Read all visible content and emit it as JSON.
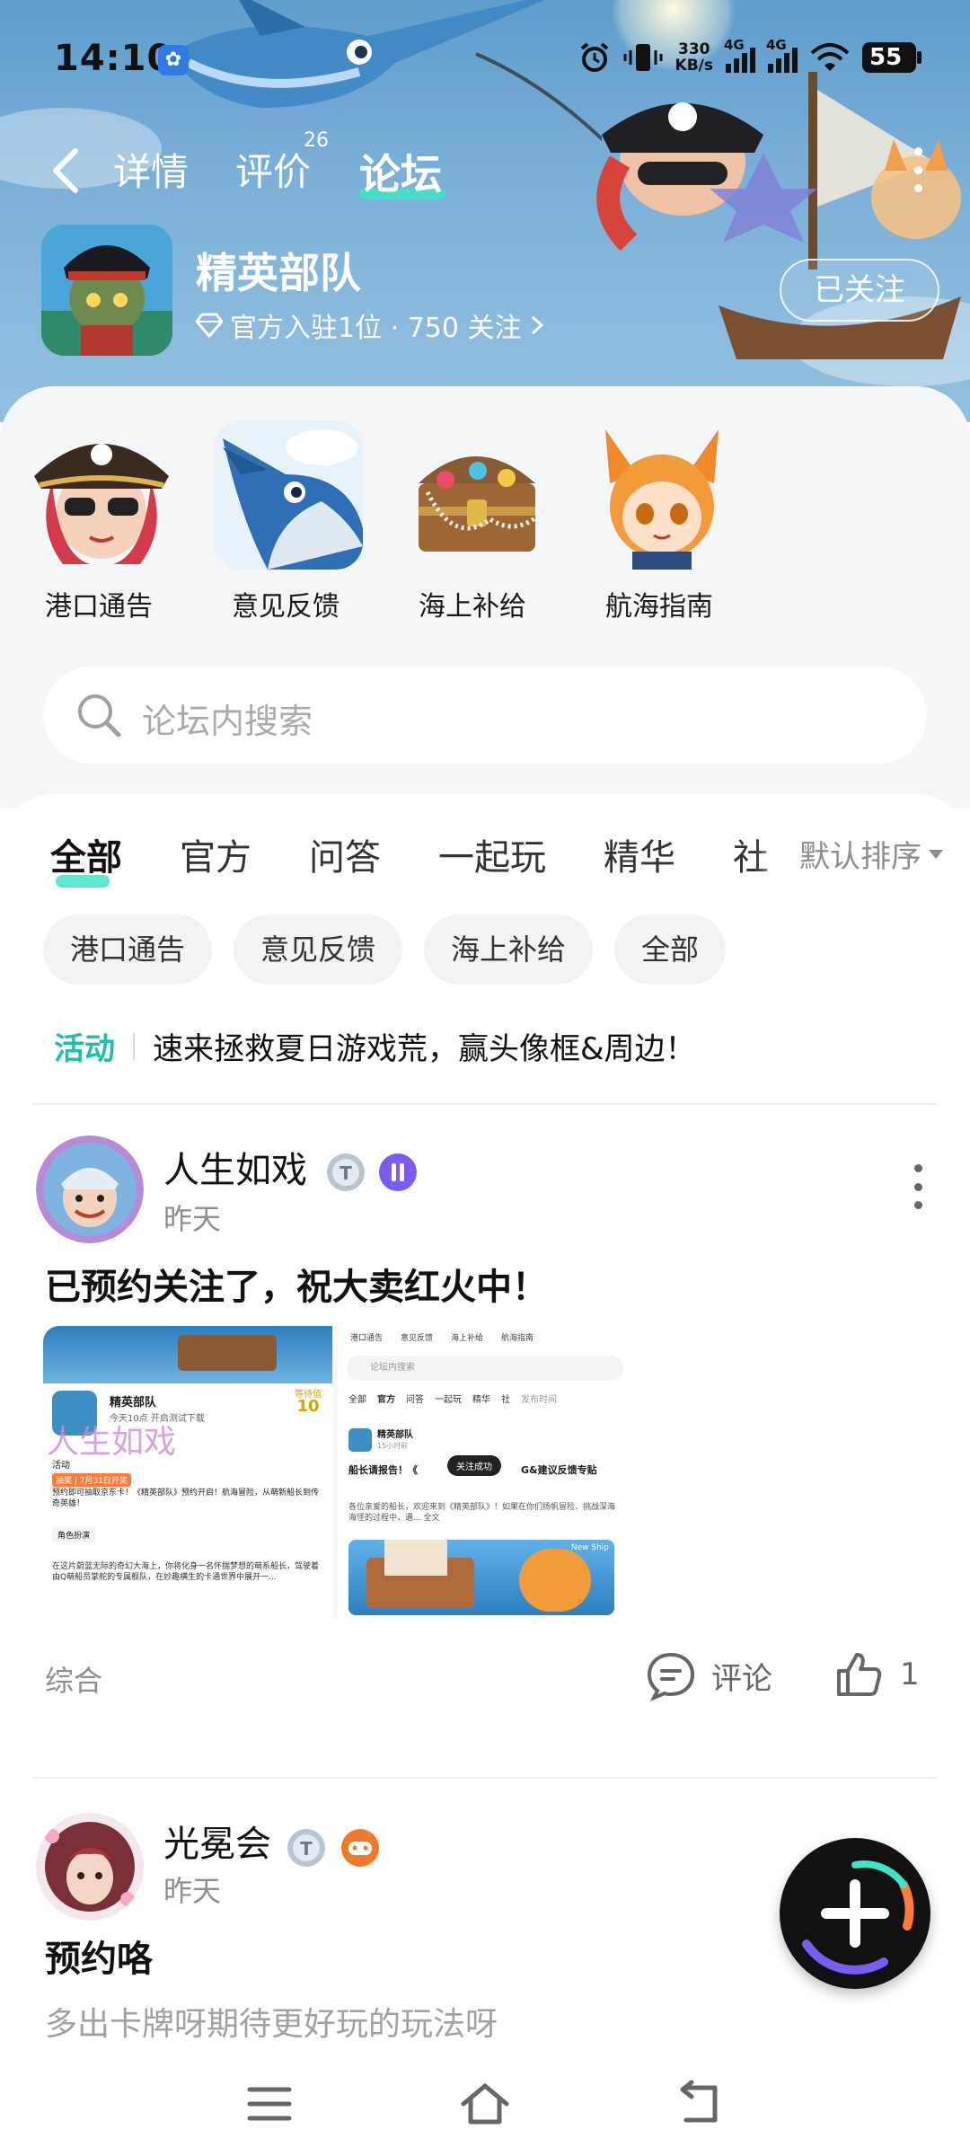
{
  "status_bar": {
    "time": "14:10",
    "app_icon": "baidu-paw-icon",
    "net_speed_value": "330",
    "net_speed_unit": "KB/s",
    "signal_1": "4G",
    "signal_2": "4G",
    "battery": "55"
  },
  "header": {
    "back_icon": "chevron-left-icon",
    "tabs": [
      {
        "label": "详情",
        "active": false
      },
      {
        "label": "评价",
        "badge": "26",
        "active": false
      },
      {
        "label": "论坛",
        "active": true
      }
    ],
    "more_icon": "more-vertical-icon"
  },
  "forum": {
    "name": "精英部队",
    "meta_text": "官方入驻1位 · 750 关注",
    "follow_label": "已关注"
  },
  "shortcuts": [
    {
      "label": "港口通告",
      "icon": "pirate-girl-icon"
    },
    {
      "label": "意见反馈",
      "icon": "swordfish-icon"
    },
    {
      "label": "海上补给",
      "icon": "treasure-chest-icon"
    },
    {
      "label": "航海指南",
      "icon": "fox-girl-icon"
    }
  ],
  "search": {
    "placeholder": "论坛内搜索"
  },
  "feed_tabs": [
    {
      "label": "全部",
      "active": true
    },
    {
      "label": "官方",
      "active": false
    },
    {
      "label": "问答",
      "active": false
    },
    {
      "label": "一起玩",
      "active": false
    },
    {
      "label": "精华",
      "active": false
    },
    {
      "label": "社",
      "active": false
    }
  ],
  "sort_label": "默认排序",
  "chips": [
    "港口通告",
    "意见反馈",
    "海上补给",
    "全部"
  ],
  "activity": {
    "tag": "活动",
    "text": "速来拯救夏日游戏荒，赢头像框&周边！"
  },
  "posts": [
    {
      "author": "人生如戏",
      "time": "昨天",
      "title": "已预约关注了，祝大卖红火中！",
      "category": "综合",
      "comment_label": "评论",
      "likes": "1",
      "shot1": {
        "tabs": [
          "港口通告",
          "意见反馈",
          "海上补给",
          "航海指南"
        ],
        "forum": "精英部队",
        "forum_sub": "今天10点 开启测试下载",
        "badge_label": "等待值",
        "badge_num": "10",
        "watermark": "人生如戏",
        "activity": "活动",
        "pill": "抽奖 | 7月31日开奖",
        "pill_text": "预约即可抽取京东卡！《精英部队》预约开启！航海冒险，从萌新船长到传奇英雄！",
        "role_label": "角色扮演",
        "story": "在这片蔚蓝无际的奇幻大海上，你将化身一名怀揣梦想的萌系船长，驾驶着由Q萌船员掌舵的专属舰队，在妙趣横生的卡通世界中展开一..."
      },
      "shot2": {
        "search": "论坛内搜索",
        "tabs": [
          "全部",
          "官方",
          "问答",
          "一起玩",
          "精华",
          "社"
        ],
        "sort": "发布时间",
        "forum": "精英部队",
        "forum_time": "15小时前",
        "post_title": "船长请报告！《",
        "post_title_end": "G&建议反馈专贴",
        "toast": "关注成功",
        "post_body": "各位亲爱的船长，欢迎来到《精英部队》！如果在你们扬帆冒险、挑战深海海怪的过程中，遇... 全文",
        "banner_tag": "New Ship"
      }
    },
    {
      "author": "光冕会",
      "time": "昨天",
      "title": "预约咯",
      "body": "多出卡牌呀期待更好玩的玩法呀"
    }
  ],
  "fab_icon": "plus-icon",
  "nav": [
    "menu-icon",
    "home-icon",
    "back-icon"
  ],
  "colors": {
    "accent": "#3fe3c6",
    "activity": "#1fbfa8",
    "hero": "#6aa7d4"
  }
}
